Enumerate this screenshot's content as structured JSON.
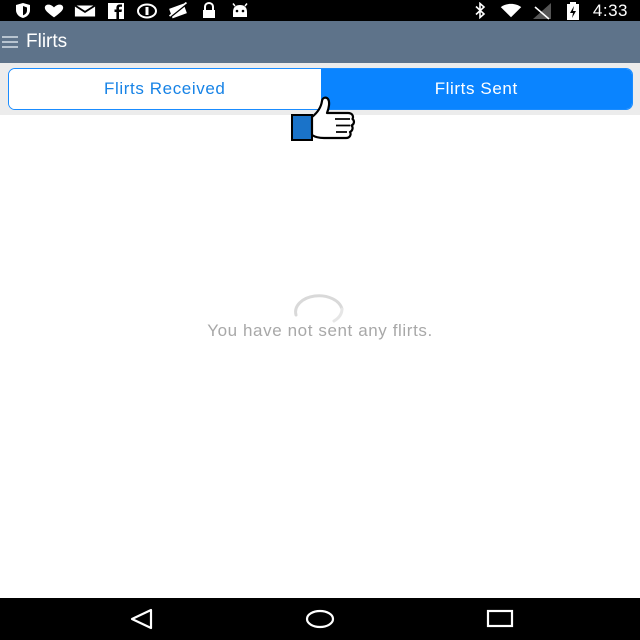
{
  "status_bar": {
    "time": "4:33",
    "left_icons": [
      "shield-icon",
      "heart-icon",
      "mail-icon",
      "facebook-icon",
      "vpn-icon",
      "no-location-icon",
      "lock-icon",
      "android-icon"
    ],
    "right_icons": [
      "bluetooth-icon",
      "wifi-icon",
      "no-signal-icon",
      "battery-charging-icon"
    ]
  },
  "app_bar": {
    "title": "Flirts",
    "background": "#5e738a",
    "menu_icon": "hamburger-menu-icon"
  },
  "tabs": {
    "items": [
      {
        "label": "Flirts Received",
        "selected": false
      },
      {
        "label": "Flirts Sent",
        "selected": true
      }
    ],
    "accent": "#0a84ff"
  },
  "content": {
    "icon": "thumbs-up-icon",
    "loading_icon": "spinner-icon",
    "empty_message": "You have not sent any flirts."
  },
  "nav_bar": {
    "buttons": [
      "back-triangle-icon",
      "home-circle-icon",
      "recents-square-icon"
    ]
  }
}
